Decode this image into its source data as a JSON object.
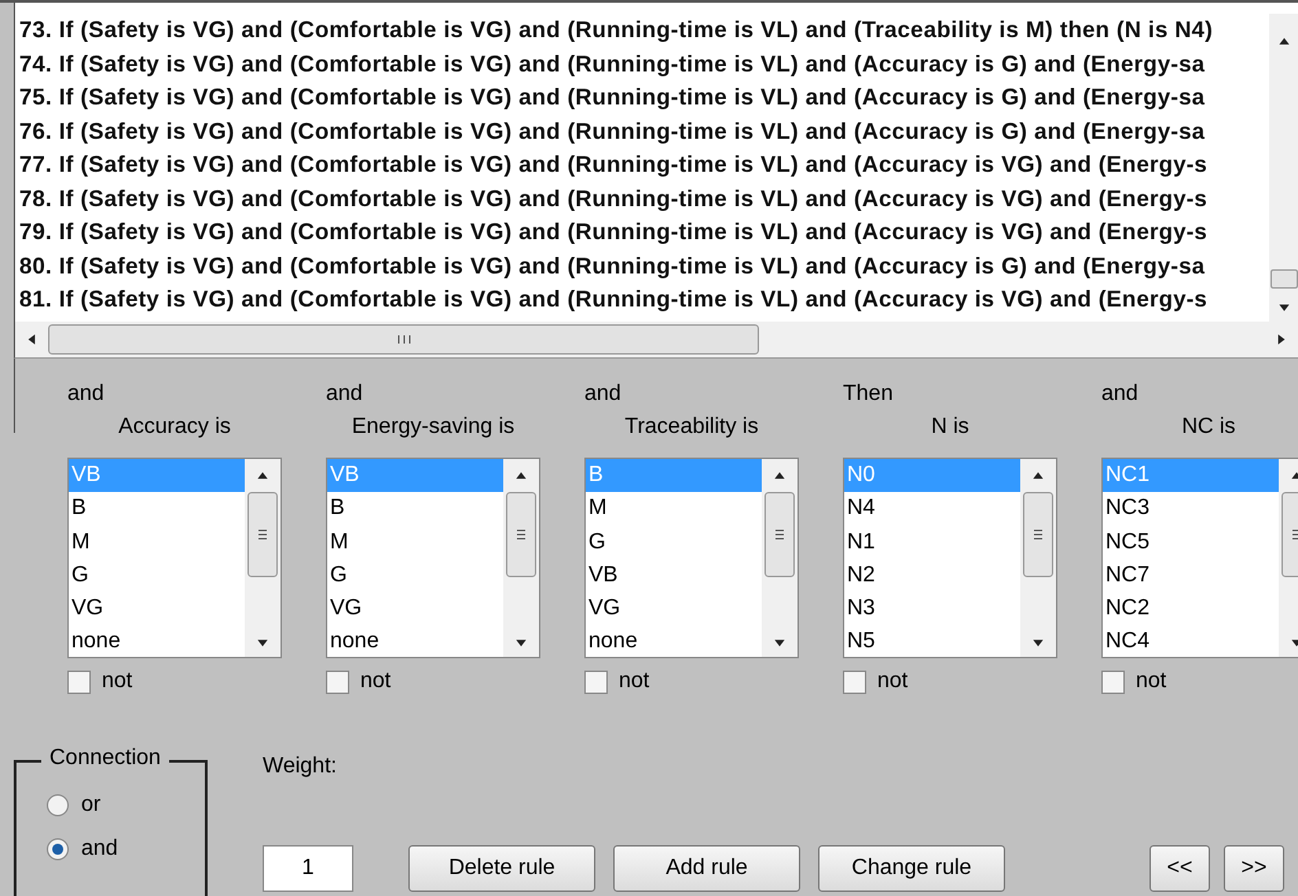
{
  "rules": [
    "73. If (Safety is VG) and (Comfortable is VG) and (Running-time is VL) and (Traceability is M) then (N is N4)",
    "74. If (Safety is VG) and (Comfortable is VG) and (Running-time is VL) and (Accuracy is G) and (Energy-sa",
    "75. If (Safety is VG) and (Comfortable is VG) and (Running-time is VL) and (Accuracy is G) and (Energy-sa",
    "76. If (Safety is VG) and (Comfortable is VG) and (Running-time is VL) and (Accuracy is G) and (Energy-sa",
    "77. If (Safety is VG) and (Comfortable is VG) and (Running-time is VL) and (Accuracy is VG) and (Energy-s",
    "78. If (Safety is VG) and (Comfortable is VG) and (Running-time is VL) and (Accuracy is VG) and (Energy-s",
    "79. If (Safety is VG) and (Comfortable is VG) and (Running-time is VL) and (Accuracy is VG) and (Energy-s",
    "80. If (Safety is VG) and (Comfortable is VG) and (Running-time is VL) and (Accuracy is G) and (Energy-sa",
    "81. If (Safety is VG) and (Comfortable is VG) and (Running-time is VL) and (Accuracy is VG) and (Energy-s"
  ],
  "variables": [
    {
      "connective": "and",
      "title": "Accuracy is",
      "options": [
        {
          "label": "VB",
          "selected": true
        },
        {
          "label": "B",
          "selected": false
        },
        {
          "label": "M",
          "selected": false
        },
        {
          "label": "G",
          "selected": false
        },
        {
          "label": "VG",
          "selected": false
        },
        {
          "label": "none",
          "selected": false
        }
      ],
      "not": false,
      "not_label": "not"
    },
    {
      "connective": "and",
      "title": "Energy-saving is",
      "options": [
        {
          "label": "VB",
          "selected": true
        },
        {
          "label": "B",
          "selected": false
        },
        {
          "label": "M",
          "selected": false
        },
        {
          "label": "G",
          "selected": false
        },
        {
          "label": "VG",
          "selected": false
        },
        {
          "label": "none",
          "selected": false
        }
      ],
      "not": false,
      "not_label": "not"
    },
    {
      "connective": "and",
      "title": "Traceability is",
      "options": [
        {
          "label": "B",
          "selected": true
        },
        {
          "label": "M",
          "selected": false
        },
        {
          "label": "G",
          "selected": false
        },
        {
          "label": "VB",
          "selected": false
        },
        {
          "label": "VG",
          "selected": false
        },
        {
          "label": "none",
          "selected": false
        }
      ],
      "not": false,
      "not_label": "not"
    },
    {
      "connective": "Then",
      "title": "N is",
      "options": [
        {
          "label": "N0",
          "selected": true
        },
        {
          "label": "N4",
          "selected": false
        },
        {
          "label": "N1",
          "selected": false
        },
        {
          "label": "N2",
          "selected": false
        },
        {
          "label": "N3",
          "selected": false
        },
        {
          "label": "N5",
          "selected": false
        }
      ],
      "not": false,
      "not_label": "not"
    },
    {
      "connective": "and",
      "title": "NC is",
      "options": [
        {
          "label": "NC1",
          "selected": true
        },
        {
          "label": "NC3",
          "selected": false
        },
        {
          "label": "NC5",
          "selected": false
        },
        {
          "label": "NC7",
          "selected": false
        },
        {
          "label": "NC2",
          "selected": false
        },
        {
          "label": "NC4",
          "selected": false
        }
      ],
      "not": false,
      "not_label": "not"
    }
  ],
  "connection": {
    "title": "Connection",
    "options": [
      {
        "label": "or",
        "selected": false
      },
      {
        "label": "and",
        "selected": true
      }
    ]
  },
  "weight": {
    "label": "Weight:",
    "value": "1"
  },
  "buttons": [
    {
      "label": "Delete rule",
      "kind": "action"
    },
    {
      "label": "Add rule",
      "kind": "action"
    },
    {
      "label": "Change rule",
      "kind": "action"
    },
    {
      "label": "<<",
      "kind": "nav"
    },
    {
      "label": ">>",
      "kind": "nav"
    }
  ]
}
